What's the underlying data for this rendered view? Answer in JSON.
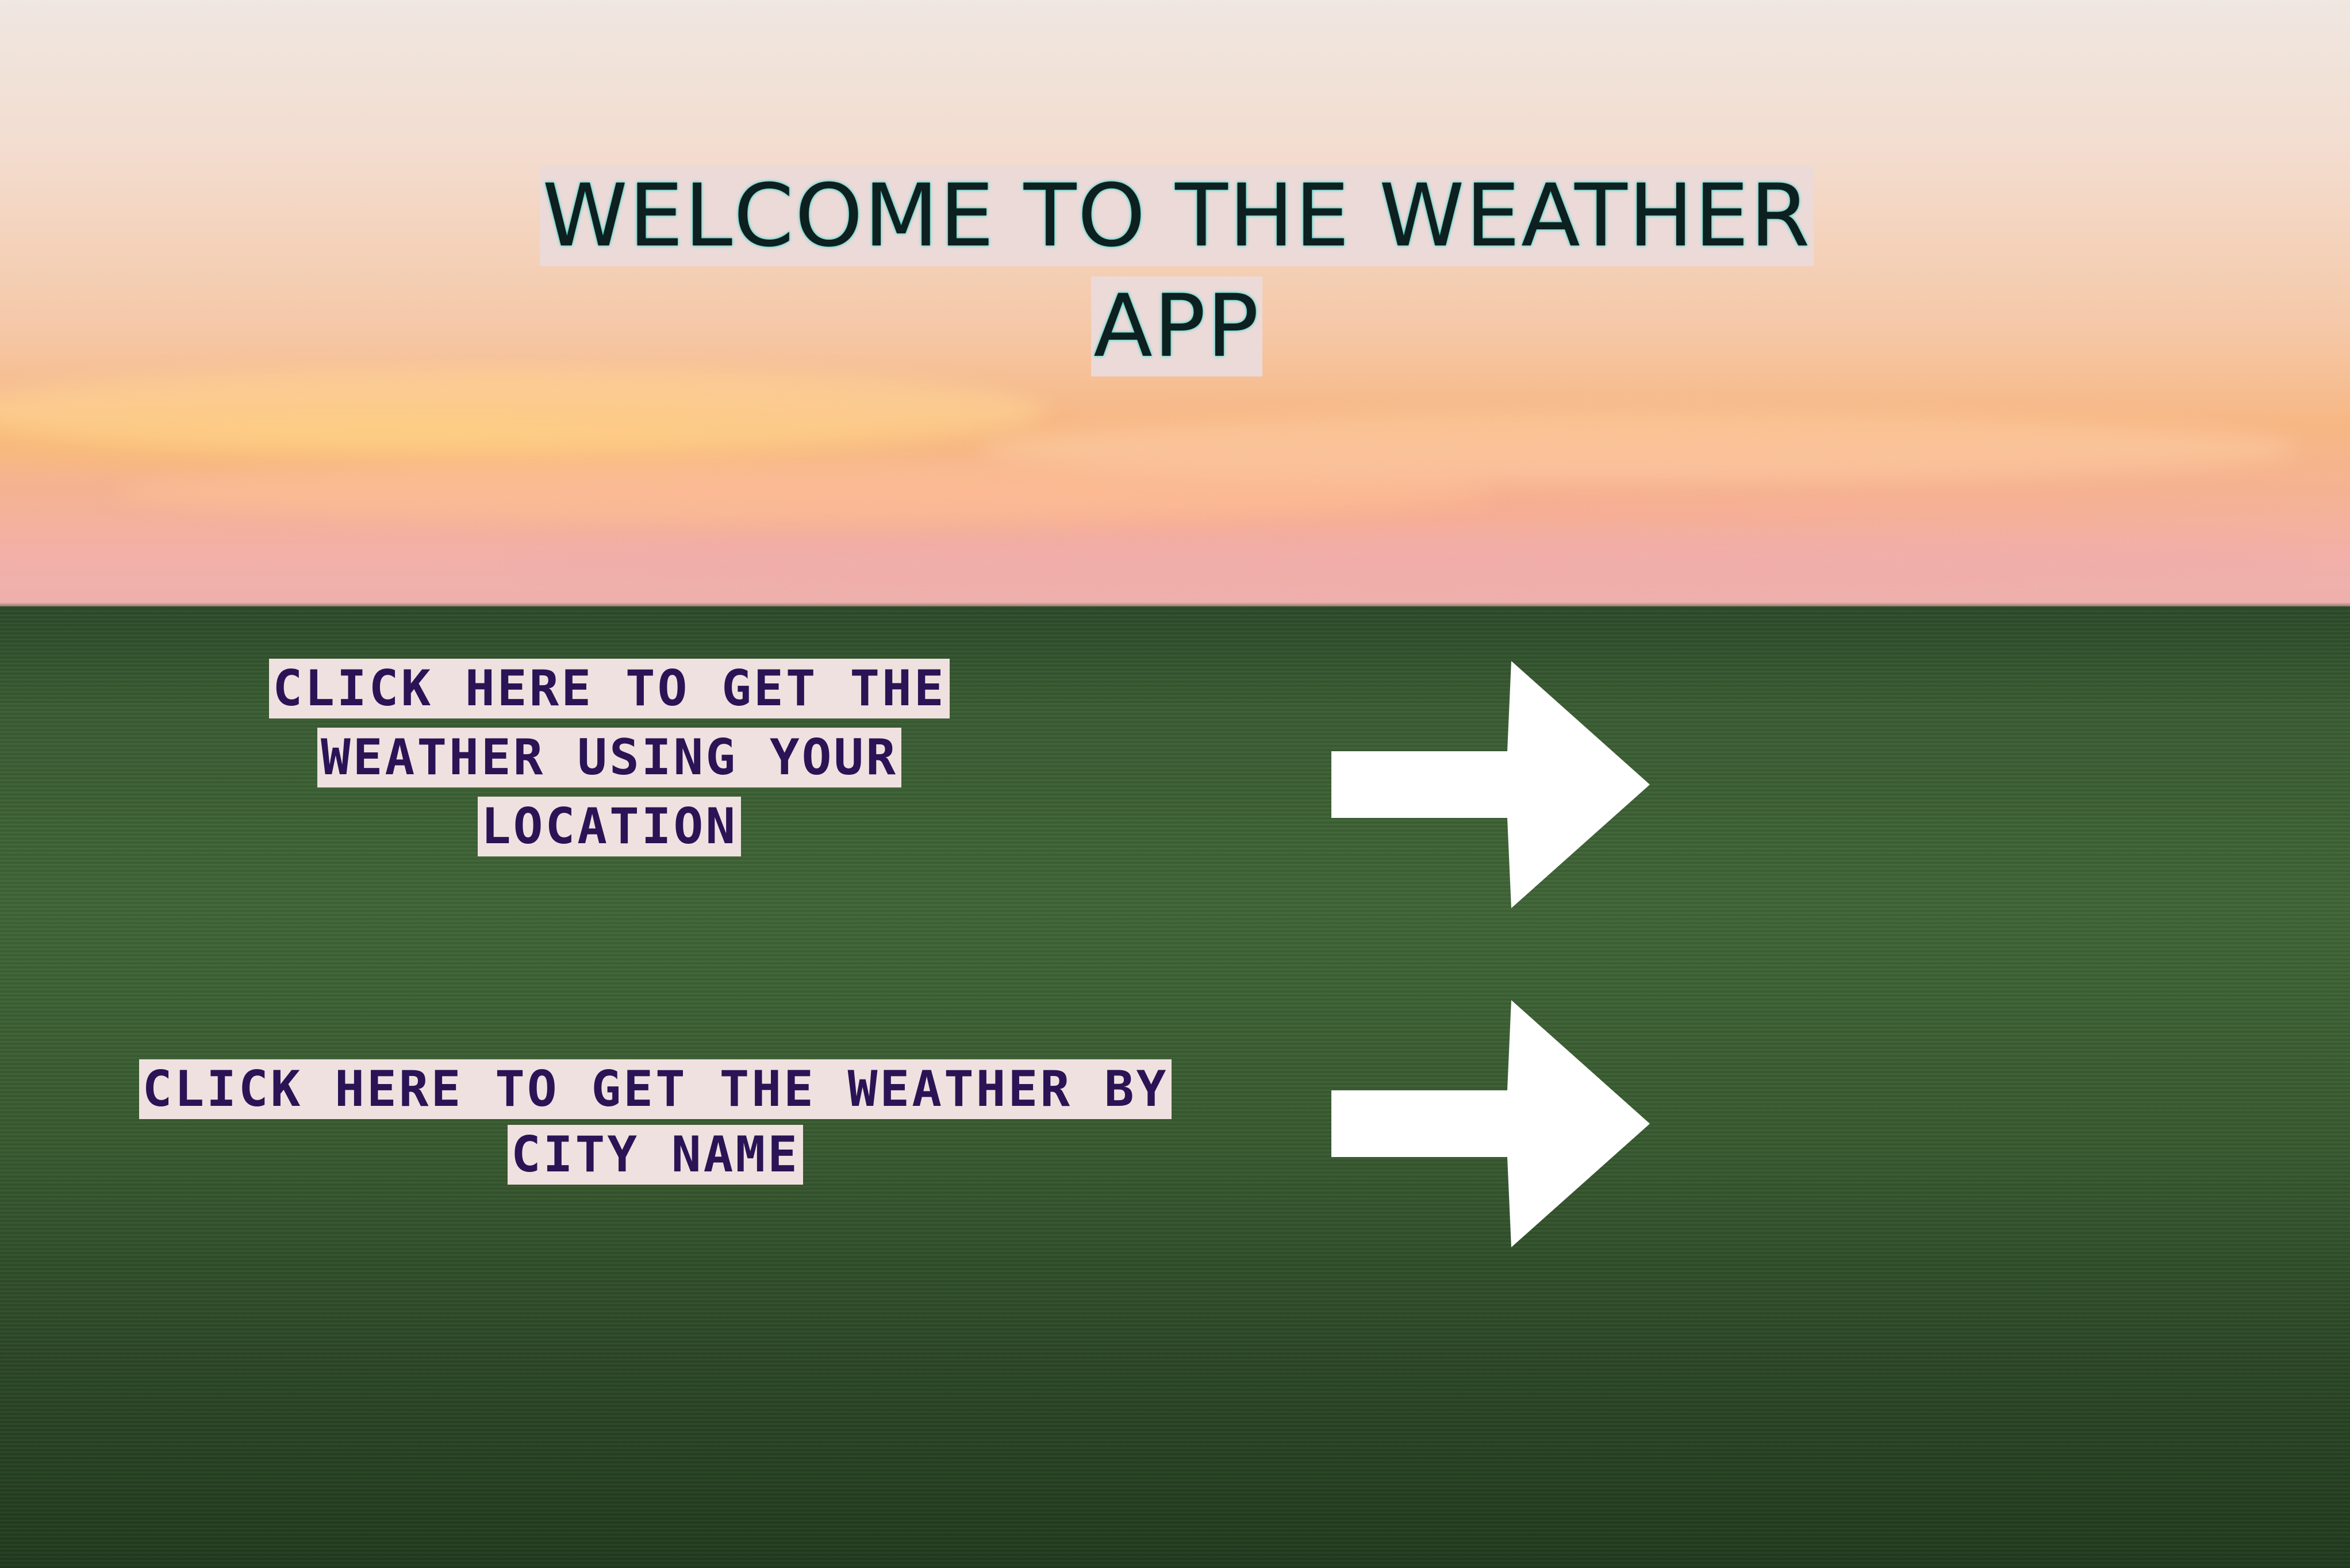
{
  "background": {
    "icon": "sunset-grass-field-photo",
    "sky_color": "#f5c9a9",
    "field_color": "#3a5c33"
  },
  "title": {
    "line1": "WELCOME TO THE WEATHER",
    "line2": "APP"
  },
  "actions": [
    {
      "lines": [
        "CLICK HERE TO GET THE",
        "WEATHER USING YOUR",
        "LOCATION"
      ],
      "icon": "arrow-right-icon"
    },
    {
      "lines": [
        "CLICK HERE TO GET THE WEATHER BY",
        "CITY NAME"
      ],
      "icon": "arrow-right-icon"
    }
  ],
  "colors": {
    "title_text": "#0d1f1f",
    "title_glow": "#2dd4c8",
    "label_text": "#2a1456",
    "label_bg": "#efe1df",
    "arrow": "#ffffff"
  }
}
